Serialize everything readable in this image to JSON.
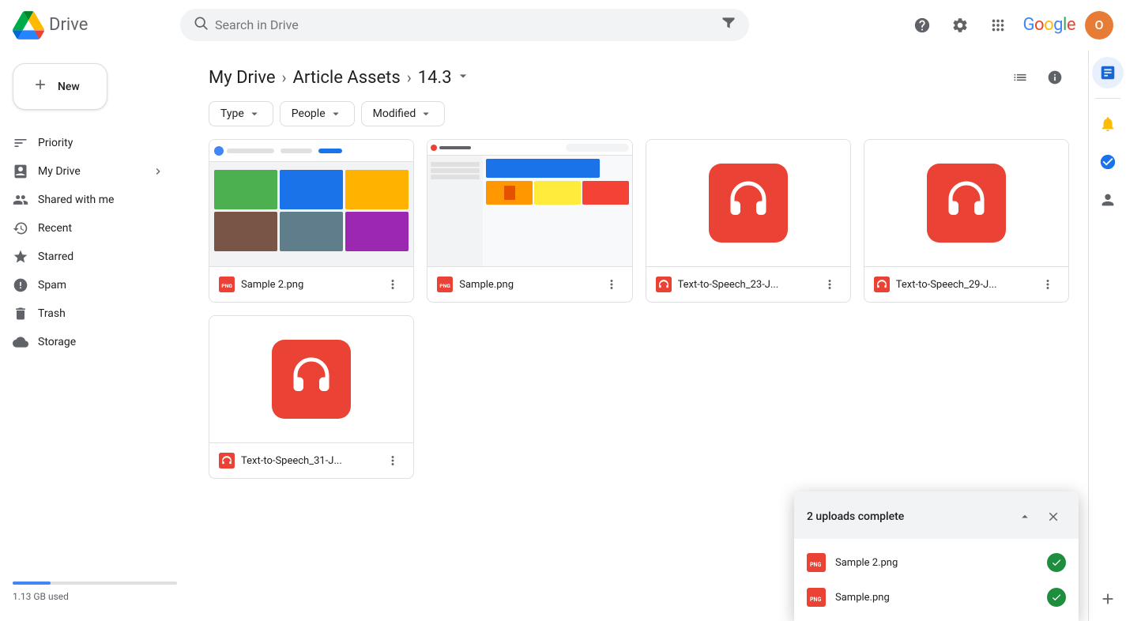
{
  "app": {
    "name": "Drive",
    "logo_alt": "Google Drive"
  },
  "topbar": {
    "search_placeholder": "Search in Drive",
    "help_icon": "?",
    "settings_icon": "⚙",
    "apps_icon": "⋮⋮⋮",
    "google_logo": "Google",
    "avatar_letter": "O"
  },
  "sidebar": {
    "new_button": "New",
    "items": [
      {
        "id": "priority",
        "label": "Priority",
        "icon": "☰"
      },
      {
        "id": "my-drive",
        "label": "My Drive",
        "icon": "🖴"
      },
      {
        "id": "shared-with-me",
        "label": "Shared with me",
        "icon": "👤"
      },
      {
        "id": "recent",
        "label": "Recent",
        "icon": "🕐"
      },
      {
        "id": "starred",
        "label": "Starred",
        "icon": "☆"
      },
      {
        "id": "spam",
        "label": "Spam",
        "icon": "⚠"
      },
      {
        "id": "trash",
        "label": "Trash",
        "icon": "🗑"
      },
      {
        "id": "storage",
        "label": "Storage",
        "icon": "☁"
      }
    ],
    "storage_used": "1.13 GB used"
  },
  "breadcrumb": {
    "root": "My Drive",
    "parent": "Article Assets",
    "current": "14.3",
    "separator": "›"
  },
  "filters": [
    {
      "id": "type",
      "label": "Type"
    },
    {
      "id": "people",
      "label": "People"
    },
    {
      "id": "modified",
      "label": "Modified"
    }
  ],
  "files": [
    {
      "id": "sample2",
      "name": "Sample 2.png",
      "type": "png",
      "thumbnail": "screenshot"
    },
    {
      "id": "sample",
      "name": "Sample.png",
      "type": "png",
      "thumbnail": "screenshot2"
    },
    {
      "id": "tts23",
      "name": "Text-to-Speech_23-J...",
      "type": "audio",
      "thumbnail": "audio"
    },
    {
      "id": "tts29",
      "name": "Text-to-Speech_29-J...",
      "type": "audio",
      "thumbnail": "audio"
    },
    {
      "id": "tts31",
      "name": "Text-to-Speech_31-J...",
      "type": "audio",
      "thumbnail": "audio"
    }
  ],
  "right_panel": {
    "icons": [
      "detail",
      "info",
      "sheets",
      "alerts",
      "tasks",
      "contacts"
    ]
  },
  "upload_notification": {
    "title": "2 uploads complete",
    "collapse_label": "collapse",
    "close_label": "close",
    "items": [
      {
        "id": "sample2-upload",
        "name": "Sample 2.png",
        "status": "complete"
      },
      {
        "id": "sample-upload",
        "name": "Sample.png",
        "status": "complete"
      }
    ]
  }
}
